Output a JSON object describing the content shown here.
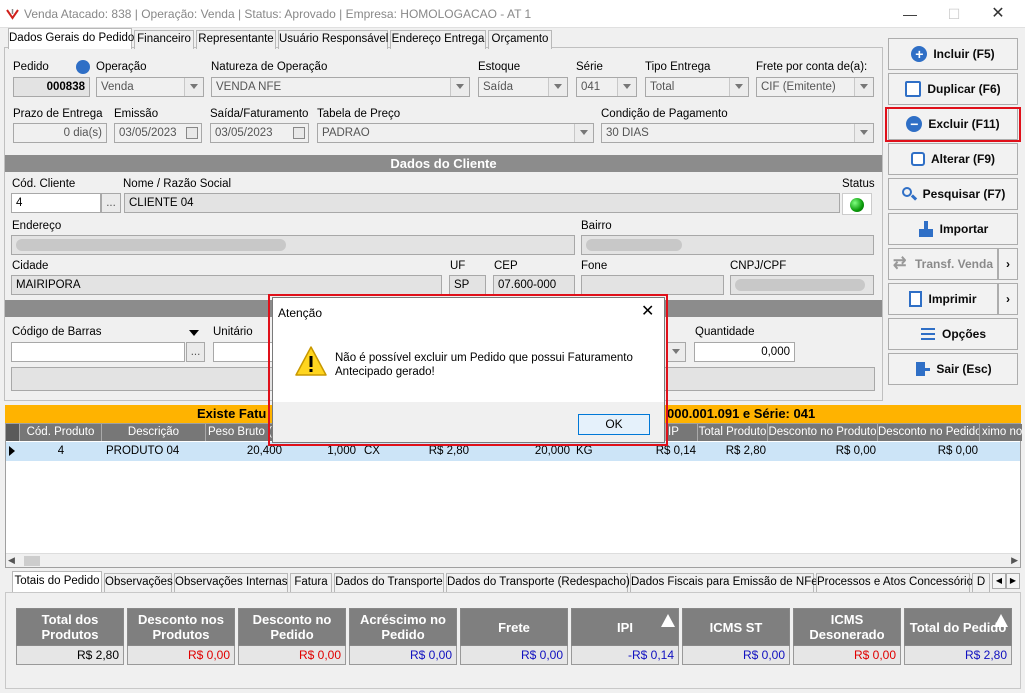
{
  "window": {
    "title": "Venda Atacado: 838 | Operação: Venda | Status: Aprovado | Empresa: HOMOLOGACAO - AT 1"
  },
  "tabs": [
    "Dados Gerais do Pedido",
    "Financeiro",
    "Representante",
    "Usuário Responsável",
    "Endereço Entrega",
    "Orçamento"
  ],
  "pedido": {
    "pedido_label": "Pedido",
    "pedido_value": "000838",
    "operacao_label": "Operação",
    "operacao_value": "Venda",
    "natureza_label": "Natureza de Operação",
    "natureza_value": "VENDA NFE",
    "estoque_label": "Estoque",
    "estoque_value": "Saída",
    "serie_label": "Série",
    "serie_value": "041",
    "tipo_label": "Tipo Entrega",
    "tipo_value": "Total",
    "frete_label": "Frete por conta de(a):",
    "frete_value": "CIF (Emitente)",
    "prazo_label": "Prazo de Entrega",
    "prazo_value": "0 dia(s)",
    "emissao_label": "Emissão",
    "emissao_value": "03/05/2023",
    "saida_label": "Saída/Faturamento",
    "saida_value": "03/05/2023",
    "tabela_label": "Tabela de Preço",
    "tabela_value": "PADRAO",
    "condicao_label": "Condição de Pagamento",
    "condicao_value": "30 DIAS"
  },
  "cliente": {
    "section_title": "Dados do Cliente",
    "cod_label": "Cód. Cliente",
    "cod_value": "4",
    "nome_label": "Nome / Razão Social",
    "nome_value": "CLIENTE 04",
    "status_label": "Status",
    "endereco_label": "Endereço",
    "bairro_label": "Bairro",
    "cidade_label": "Cidade",
    "cidade_value": "MAIRIPORA",
    "uf_label": "UF",
    "uf_value": "SP",
    "cep_label": "CEP",
    "cep_value": "07.600-000",
    "fone_label": "Fone",
    "cnpj_label": "CNPJ/CPF",
    "lookup_btn": "..."
  },
  "produto": {
    "barras_label": "Código de Barras",
    "unitario_label": "Unitário",
    "quantidade_label": "Quantidade",
    "quantidade_value": "0,000",
    "lookup_btn": "..."
  },
  "banner": {
    "left": "Existe Fatu",
    "right": "000.001.091 e Série: 041"
  },
  "grid": {
    "headers": [
      "Cód. Produto",
      "Descrição",
      "Peso Bruto (",
      "IP",
      "Total Produto",
      "Desconto no Produto",
      "Desconto no Pedido",
      "ximo no I"
    ],
    "row": {
      "cod": "4",
      "desc": "PRODUTO 04",
      "peso": "20,400",
      "qtd": "1,000",
      "un": "CX",
      "unit": "R$ 2,80",
      "peso2": "20,000",
      "un2": "KG",
      "ipi": "R$ 0,14",
      "total": "R$ 2,80",
      "desc_prod": "R$ 0,00",
      "desc_ped": "R$ 0,00"
    }
  },
  "bottom_tabs": [
    "Totais do Pedido",
    "Observações",
    "Observações Internas",
    "Fatura",
    "Dados do Transporte",
    "Dados do Transporte (Redespacho)",
    "Dados Fiscais para Emissão de NFe",
    "Processos e Atos Concessório",
    "D"
  ],
  "totals": [
    {
      "label": "Total dos Produtos",
      "value": "R$ 2,80",
      "color": "#000000"
    },
    {
      "label": "Desconto nos Produtos",
      "value": "R$ 0,00",
      "color": "#e00000"
    },
    {
      "label": "Desconto no Pedido",
      "value": "R$ 0,00",
      "color": "#e00000"
    },
    {
      "label": "Acréscimo no Pedido",
      "value": "R$ 0,00",
      "color": "#1010c0"
    },
    {
      "label": "Frete",
      "value": "R$ 0,00",
      "color": "#1010c0"
    },
    {
      "label": "IPI",
      "value": "-R$ 0,14",
      "color": "#1010c0"
    },
    {
      "label": "ICMS ST",
      "value": "R$ 0,00",
      "color": "#1010c0"
    },
    {
      "label": "ICMS Desonerado",
      "value": "R$ 0,00",
      "color": "#e00000"
    },
    {
      "label": "Total do Pedido",
      "value": "R$ 2,80",
      "color": "#1010c0"
    }
  ],
  "actions": {
    "incluir": "Incluir (F5)",
    "duplicar": "Duplicar (F6)",
    "excluir": "Excluir (F11)",
    "alterar": "Alterar (F9)",
    "pesquisar": "Pesquisar (F7)",
    "importar": "Importar",
    "transf": "Transf. Venda",
    "imprimir": "Imprimir",
    "opcoes": "Opções",
    "sair": "Sair (Esc)"
  },
  "dialog": {
    "title": "Atenção",
    "message": "Não é possível excluir um Pedido que possui Faturamento Antecipado gerado!",
    "ok": "OK"
  },
  "colors": {
    "accent_blue": "#2f6fc6",
    "highlight_red": "#e0101a",
    "banner": "#ffb300",
    "row_selected": "#cce4f7"
  }
}
